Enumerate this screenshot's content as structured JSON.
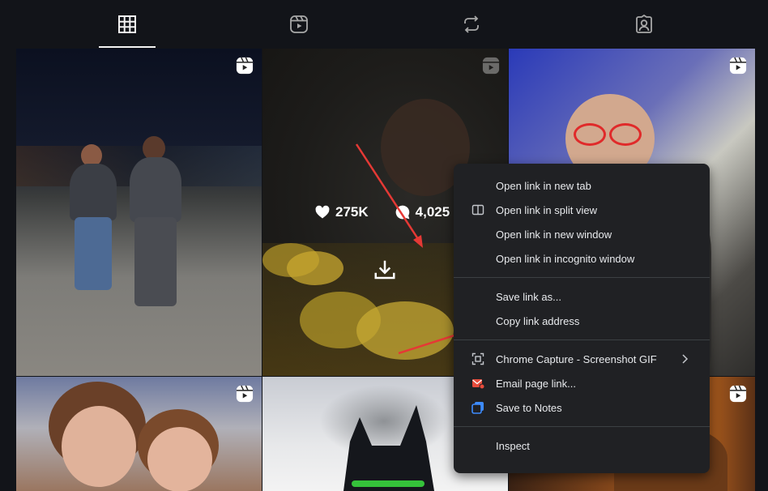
{
  "tabs": [
    {
      "name": "posts",
      "icon": "grid-icon",
      "active": true
    },
    {
      "name": "reels",
      "icon": "reels-icon",
      "active": false
    },
    {
      "name": "reposts",
      "icon": "repost-icon",
      "active": false
    },
    {
      "name": "tagged",
      "icon": "tagged-icon",
      "active": false
    }
  ],
  "hover_stats": {
    "likes": "275K",
    "comments": "4,025"
  },
  "context_menu": {
    "open_new_tab": "Open link in new tab",
    "open_split_view": "Open link in split view",
    "open_new_window": "Open link in new window",
    "open_incognito": "Open link in incognito window",
    "save_link_as": "Save link as...",
    "copy_link_address": "Copy link address",
    "chrome_capture": "Chrome Capture - Screenshot  GIF",
    "email_page_link": "Email page link...",
    "save_to_notes": "Save to Notes",
    "inspect": "Inspect"
  },
  "colors": {
    "background": "#121419",
    "menu_bg": "#202124",
    "menu_text": "#e8eaed",
    "annotation_arrow": "#e53935",
    "email_icon": "#e74c3c",
    "notes_icon": "#3d8bfd"
  }
}
